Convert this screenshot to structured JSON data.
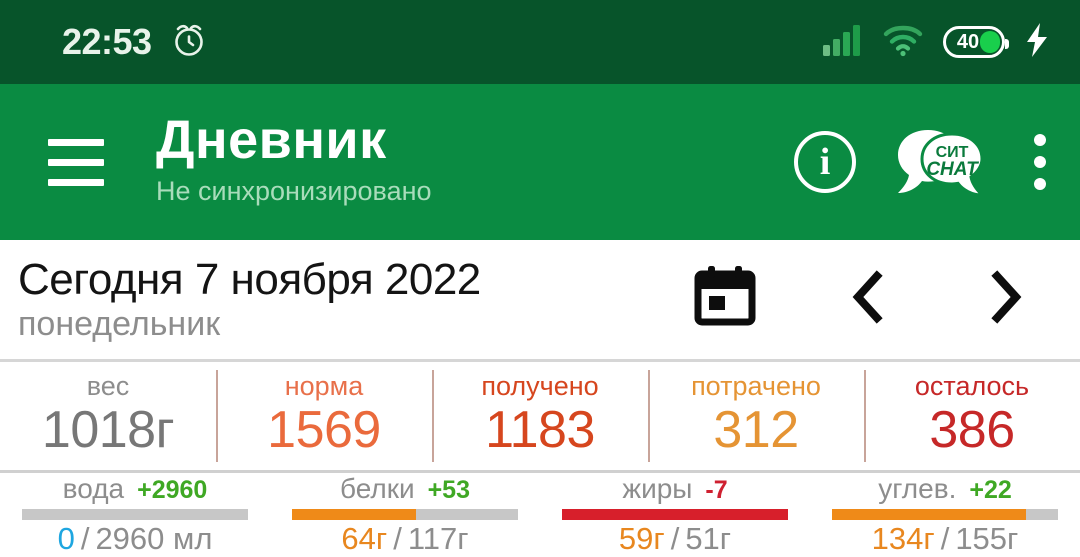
{
  "statusbar": {
    "time": "22:53",
    "alarm_icon": "alarm-clock-icon",
    "signal_icon": "signal-bars-icon",
    "wifi_icon": "wifi-icon",
    "battery_level": "40",
    "charging_icon": "lightning-bolt-icon",
    "bg": "#07542a"
  },
  "appbar": {
    "menu_icon": "hamburger-menu-icon",
    "title": "Дневник",
    "subtitle": "Не синхронизировано",
    "info_icon": "info-circle-icon",
    "info_glyph": "i",
    "chat_icon": "sit-chat-icon",
    "chat_text_top": "СИТ",
    "chat_text_bottom": "CHAT",
    "overflow_icon": "overflow-menu-icon",
    "bg": "#0a8b42"
  },
  "daterow": {
    "date": "Сегодня 7 ноября 2022",
    "weekday": "понедельник",
    "calendar_icon": "calendar-icon",
    "prev_icon": "chevron-left-icon",
    "next_icon": "chevron-right-icon"
  },
  "stats": [
    {
      "label": "вес",
      "value": "1018г",
      "label_color": "#8d8d8d",
      "value_color": "#777777"
    },
    {
      "label": "норма",
      "value": "1569",
      "label_color": "#e8704a",
      "value_color": "#ea6a3c"
    },
    {
      "label": "получено",
      "value": "1183",
      "label_color": "#d6461e",
      "value_color": "#d6461e"
    },
    {
      "label": "потрачено",
      "value": "312",
      "label_color": "#e59434",
      "value_color": "#e59434"
    },
    {
      "label": "осталось",
      "value": "386",
      "label_color": "#c62828",
      "value_color": "#c62828"
    }
  ],
  "nutrients": [
    {
      "name": "вода",
      "delta": "+2960",
      "delta_sign": "pos",
      "current": "0",
      "separator": "/",
      "total": "2960 мл",
      "current_color": "#1ea6e0",
      "progress_pct": 0,
      "bar_color": "#c7c7c7"
    },
    {
      "name": "белки",
      "delta": "+53",
      "delta_sign": "pos",
      "current": "64г",
      "separator": "/",
      "total": "117г",
      "current_color": "#e8871f",
      "progress_pct": 55,
      "bar_color": "#ef8a18"
    },
    {
      "name": "жиры",
      "delta": "-7",
      "delta_sign": "neg",
      "current": "59г",
      "separator": "/",
      "total": "51г",
      "current_color": "#e8871f",
      "progress_pct": 100,
      "bar_color": "#d71f2b"
    },
    {
      "name": "углев.",
      "delta": "+22",
      "delta_sign": "pos",
      "current": "134г",
      "separator": "/",
      "total": "155г",
      "current_color": "#e8871f",
      "progress_pct": 86,
      "bar_color": "#ef8a18"
    }
  ]
}
